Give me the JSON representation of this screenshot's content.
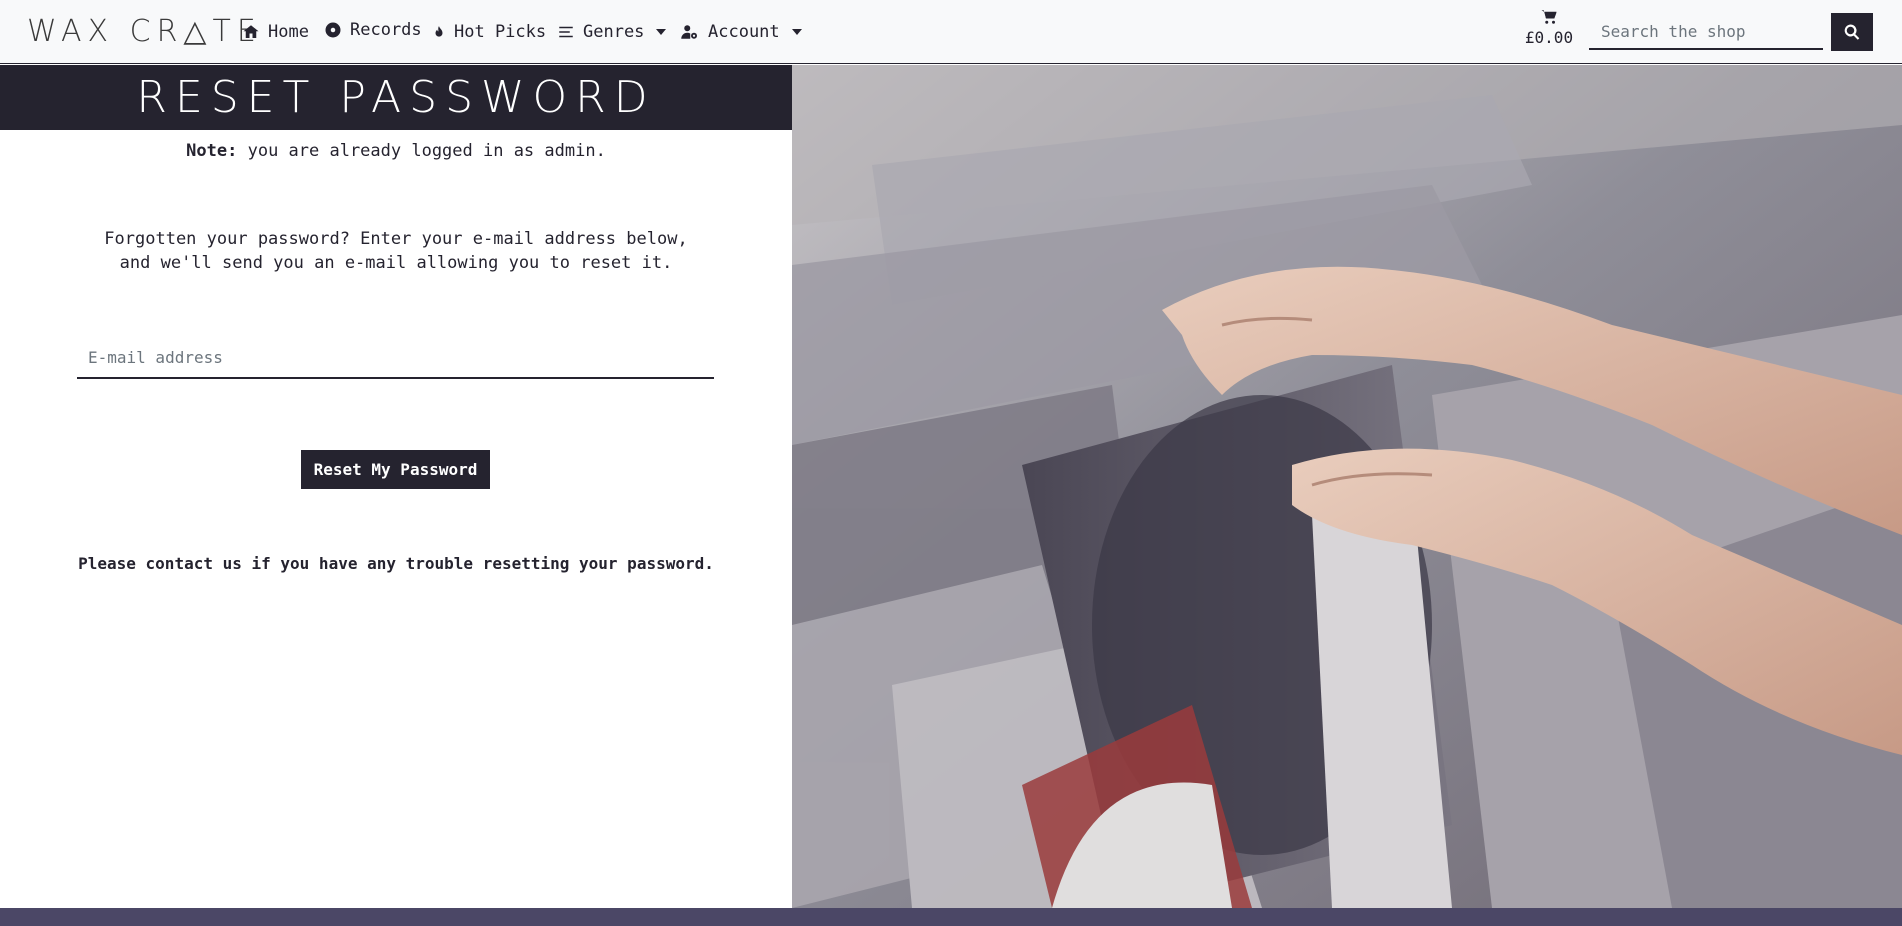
{
  "navbar": {
    "brand": "WAX CR△TE",
    "items": [
      {
        "label": "Home",
        "icon": "home-icon"
      },
      {
        "label": "Records",
        "icon": "record-icon"
      },
      {
        "label": "Hot Picks",
        "icon": "fire-icon"
      },
      {
        "label": "Genres",
        "icon": "list-icon",
        "dropdown": true
      },
      {
        "label": "Account",
        "icon": "user-cog-icon",
        "dropdown": true
      }
    ],
    "cart_total": "£0.00",
    "search": {
      "placeholder": "Search the shop"
    }
  },
  "page": {
    "title": "Reset Password",
    "note_label": "Note:",
    "note_text": " you are already logged in as admin.",
    "intro": "Forgotten your password? Enter your e-mail address below, and we'll send you an e-mail allowing you to reset it.",
    "email_placeholder": "E-mail address",
    "submit_label": "Reset My Password",
    "contact": "Please contact us if you have any trouble resetting your password."
  },
  "colors": {
    "primary": "#25232f",
    "navbar_bg": "#f8f9fa",
    "footer": "#4b4766"
  }
}
